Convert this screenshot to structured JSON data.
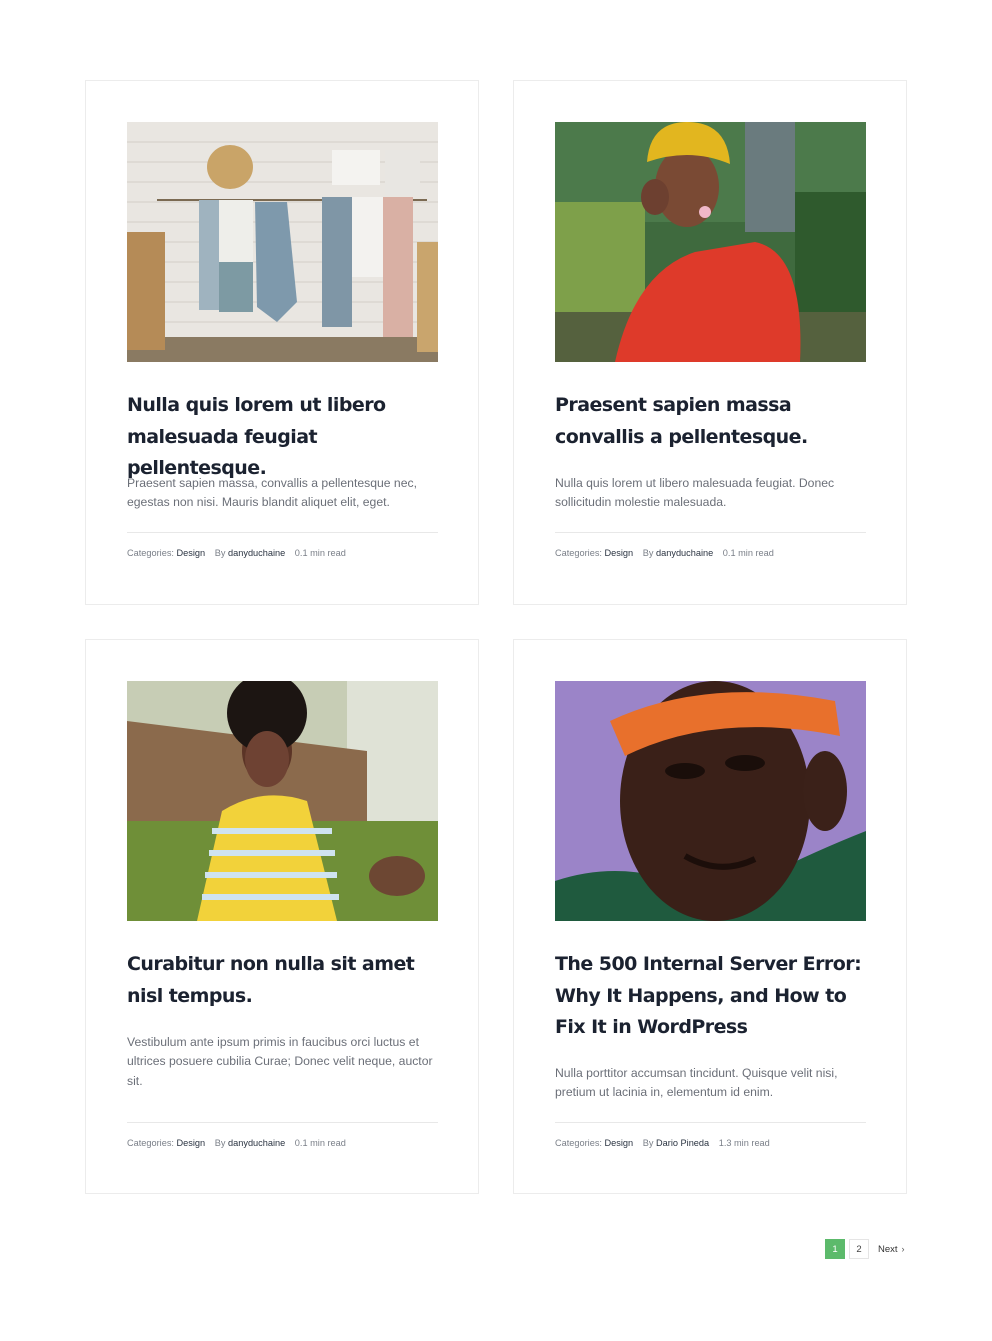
{
  "posts": [
    {
      "title": "Nulla quis lorem ut libero malesuada feugiat pellentesque.",
      "excerpt": "Praesent sapien massa, convallis a pellentesque nec, egestas non nisi. Mauris blandit aliquet elit, eget.",
      "categories_label": "Categories:",
      "category": "Design",
      "by_label": "By",
      "author": "danyduchaine",
      "read_time": "0.1 min read"
    },
    {
      "title": "Praesent sapien massa convallis a pellentesque.",
      "excerpt": "Nulla quis lorem ut libero malesuada feugiat. Donec sollicitudin molestie malesuada.",
      "categories_label": "Categories:",
      "category": "Design",
      "by_label": "By",
      "author": "danyduchaine",
      "read_time": "0.1 min read"
    },
    {
      "title": "Curabitur non nulla sit amet nisl tempus.",
      "excerpt": "Vestibulum ante ipsum primis in faucibus orci luctus et ultrices posuere cubilia Curae; Donec velit neque, auctor sit.",
      "categories_label": "Categories:",
      "category": "Design",
      "by_label": "By",
      "author": "danyduchaine",
      "read_time": "0.1 min read"
    },
    {
      "title": "The 500 Internal Server Error: Why It Happens, and How to Fix It in WordPress",
      "excerpt": "Nulla porttitor accumsan tincidunt. Quisque velit nisi, pretium ut lacinia in, elementum id enim.",
      "categories_label": "Categories:",
      "category": "Design",
      "by_label": "By",
      "author": "Dario Pineda",
      "read_time": "1.3 min read"
    }
  ],
  "pagination": {
    "pages": [
      "1",
      "2"
    ],
    "current": "1",
    "next_label": "Next",
    "accent_color": "#5cba6b"
  }
}
